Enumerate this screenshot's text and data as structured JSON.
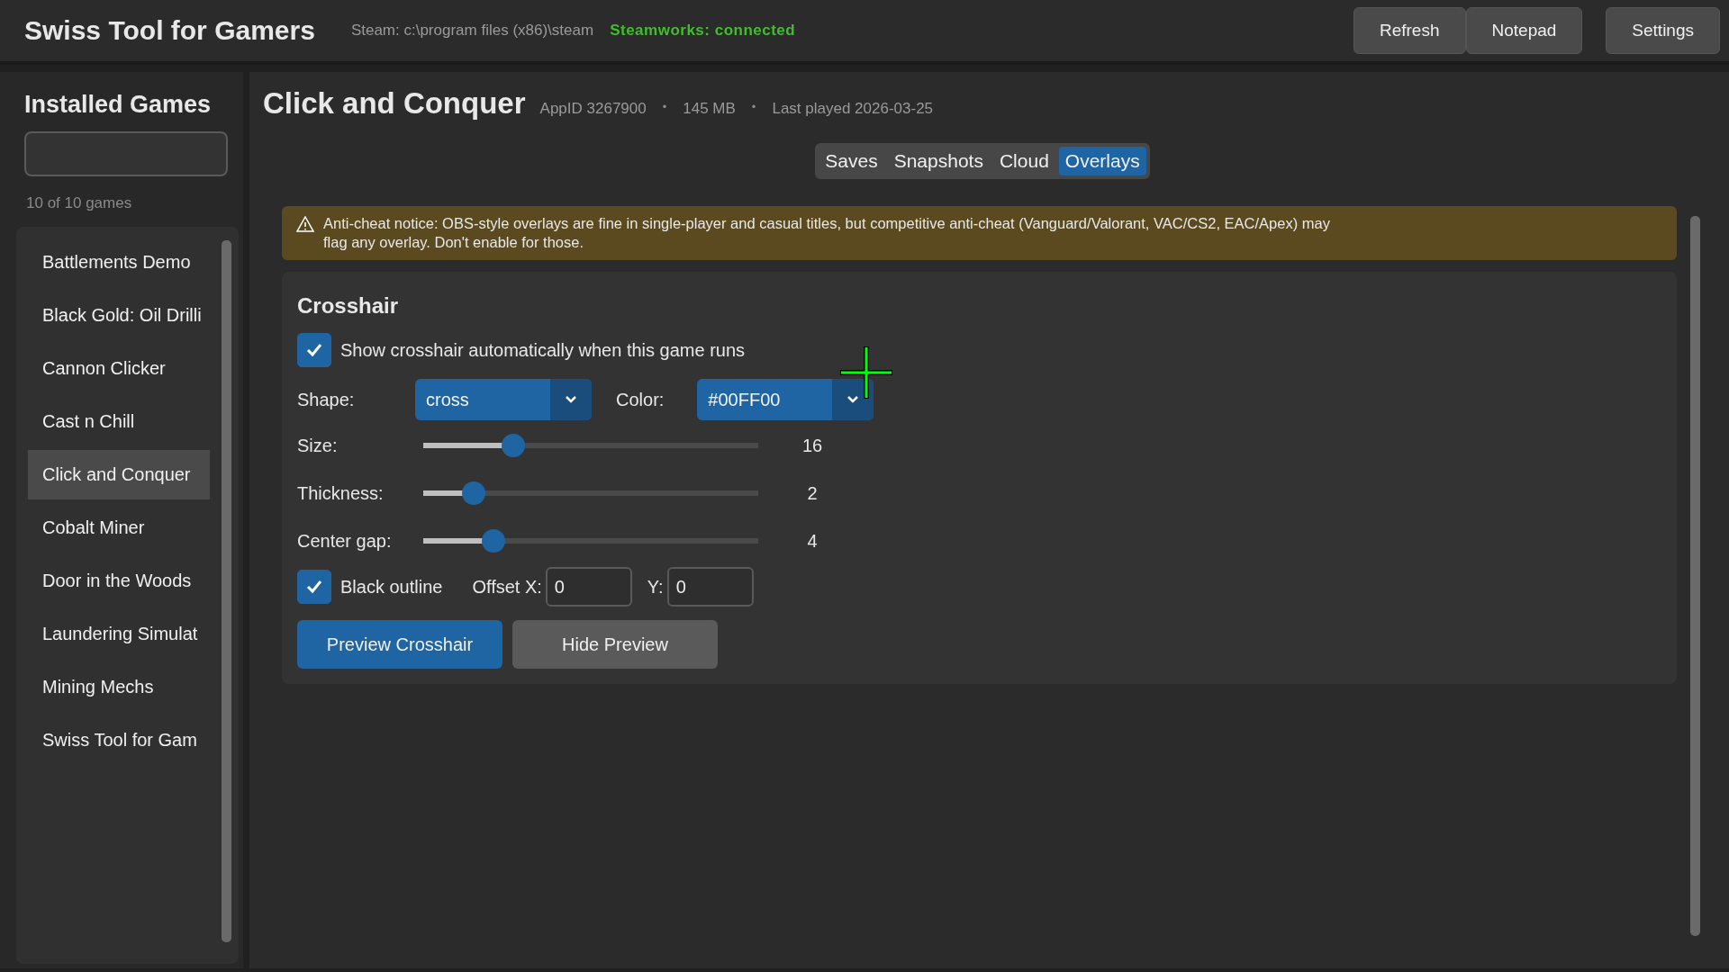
{
  "header": {
    "title": "Swiss Tool for Gamers",
    "steam_path": "Steam: c:\\program files (x86)\\steam",
    "steamworks_status": "Steamworks: connected",
    "buttons": [
      "Refresh",
      "Notepad",
      "Settings"
    ]
  },
  "sidebar": {
    "title": "Installed Games",
    "count": "10 of 10 games",
    "games": [
      {
        "name": "Battlements Demo",
        "selected": false
      },
      {
        "name": "Black Gold: Oil Drilli",
        "selected": false
      },
      {
        "name": "Cannon Clicker",
        "selected": false
      },
      {
        "name": "Cast n Chill",
        "selected": false
      },
      {
        "name": "Click and Conquer",
        "selected": true
      },
      {
        "name": "Cobalt Miner",
        "selected": false
      },
      {
        "name": "Door in the Woods",
        "selected": false
      },
      {
        "name": "Laundering Simulat",
        "selected": false
      },
      {
        "name": "Mining Mechs",
        "selected": false
      },
      {
        "name": "Swiss Tool for Gam",
        "selected": false
      }
    ]
  },
  "game": {
    "title": "Click and Conquer",
    "meta": [
      {
        "kind": "text",
        "text": "AppID 3267900"
      },
      {
        "kind": "separator",
        "text": "•"
      },
      {
        "kind": "text",
        "text": "145 MB"
      },
      {
        "kind": "separator",
        "text": "•"
      },
      {
        "kind": "text",
        "text": "Last played 2026-03-25"
      }
    ]
  },
  "tabs": [
    {
      "label": "Saves",
      "selected": false
    },
    {
      "label": "Snapshots",
      "selected": false
    },
    {
      "label": "Cloud",
      "selected": false
    },
    {
      "label": "Overlays",
      "selected": true
    }
  ],
  "notice": {
    "text": "Anti-cheat notice: OBS-style overlays are fine in single-player and casual titles, but competitive anti-cheat (Vanguard/Valorant, VAC/CS2, EAC/Apex) may flag any overlay. Don't enable for those."
  },
  "crosshair": {
    "title": "Crosshair",
    "auto_show": {
      "label": "Show crosshair automatically when this game runs",
      "checked": true
    },
    "shape": {
      "label": "Shape:",
      "value": "cross"
    },
    "color": {
      "label": "Color:",
      "value": "#00FF00"
    },
    "sliders": [
      {
        "label": "Size:",
        "level": 0.27,
        "reading": "16"
      },
      {
        "label": "Thickness:",
        "level": 0.15,
        "reading": "2"
      },
      {
        "label": "Center gap:",
        "level": 0.21,
        "reading": "4"
      }
    ],
    "outline": {
      "label": "Black outline",
      "checked": true
    },
    "offset_x": {
      "label": "Offset X:",
      "value": "0"
    },
    "offset_y": {
      "label": "Y:",
      "value": "0"
    },
    "buttons": [
      {
        "label": "Preview Crosshair",
        "kind": "primary"
      },
      {
        "label": "Hide Preview",
        "kind": "secondary"
      }
    ]
  }
}
